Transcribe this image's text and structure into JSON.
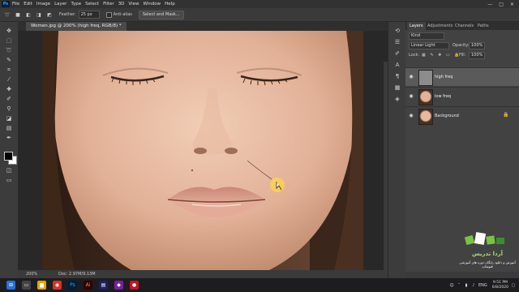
{
  "menubar": {
    "logo": "Ps",
    "items": [
      "File",
      "Edit",
      "Image",
      "Layer",
      "Type",
      "Select",
      "Filter",
      "3D",
      "View",
      "Window",
      "Help"
    ],
    "controls": [
      "—",
      "□",
      "✕"
    ]
  },
  "options": {
    "feather_label": "Feather:",
    "feather_value": "25 px",
    "antialias_label": "Anti-alias",
    "select_mask_label": "Select and Mask..."
  },
  "doc": {
    "tab_title": "Women.jpg @ 200% (high freq, RGB/8) *",
    "zoom": "200%",
    "doc_size": "Doc: 2.97M/9.13M"
  },
  "layers_panel": {
    "tabs": [
      "Layers",
      "Adjustments",
      "Channels",
      "Paths"
    ],
    "kind_label": "Kind",
    "blend_mode": "Linear Light",
    "opacity_label": "Opacity:",
    "opacity_value": "100%",
    "lock_label": "Lock:",
    "fill_label": "Fill:",
    "fill_value": "100%",
    "layers": [
      {
        "name": "high freq",
        "selected": true
      },
      {
        "name": "low freq",
        "selected": false
      },
      {
        "name": "Background",
        "selected": false
      }
    ]
  },
  "taskbar": {
    "lang": "ENG",
    "time": "9:51 PM",
    "date": "6/8/2020"
  },
  "watermark": {
    "line1": "آموزش و دانلود رایگان دوره های آموزشی فتوشاپ",
    "brand": "آردا تدریس"
  },
  "colors": {
    "accent": "#31a8ff",
    "foreground_swatch": "#000000",
    "background_swatch": "#ffffff"
  }
}
